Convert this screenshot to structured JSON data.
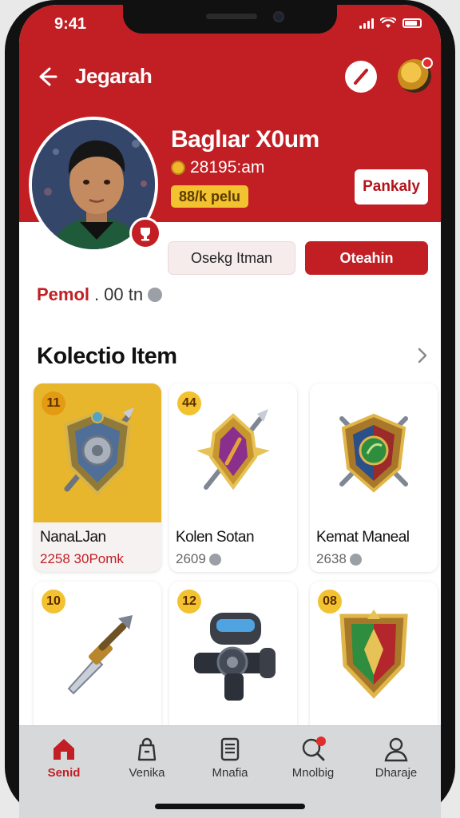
{
  "status_bar": {
    "time": "9:41"
  },
  "header": {
    "title": "Jegarah"
  },
  "profile": {
    "name": "Baglıar X0um",
    "subtitle": "28195:am",
    "level_badge": "88/k pelu",
    "follow_button": "Pankaly",
    "secondary_button": "Osekg Itman",
    "primary_button": "Oteahin",
    "info_label": "Pemol",
    "info_value": "00 tn"
  },
  "section": {
    "title": "Kolectio Item"
  },
  "items": [
    {
      "rank": "11",
      "name": "NanaLJan",
      "price": "2258 30Pomk",
      "icon": "shield-sword-icon"
    },
    {
      "rank": "44",
      "name": "Kolen Sotan",
      "price": "2609",
      "icon": "amulet-icon"
    },
    {
      "rank": "",
      "name": "Kemat Maneal",
      "price": "2638",
      "icon": "crest-shield-icon"
    },
    {
      "rank": "10",
      "name": "",
      "price": "",
      "icon": "dagger-icon"
    },
    {
      "rank": "12",
      "name": "",
      "price": "",
      "icon": "blaster-icon"
    },
    {
      "rank": "08",
      "name": "",
      "price": "",
      "icon": "heraldic-shield-icon"
    }
  ],
  "tabs": [
    {
      "label": "Senid",
      "icon": "home-icon",
      "active": true
    },
    {
      "label": "Venika",
      "icon": "bag-icon",
      "active": false
    },
    {
      "label": "Mnafia",
      "icon": "document-icon",
      "active": false
    },
    {
      "label": "Mnolbig",
      "icon": "search-icon",
      "active": false
    },
    {
      "label": "Dharaje",
      "icon": "user-icon",
      "active": false
    }
  ],
  "colors": {
    "brand_red": "#c11f24",
    "gold": "#f2c230",
    "tab_bar": "#d7d8da"
  }
}
